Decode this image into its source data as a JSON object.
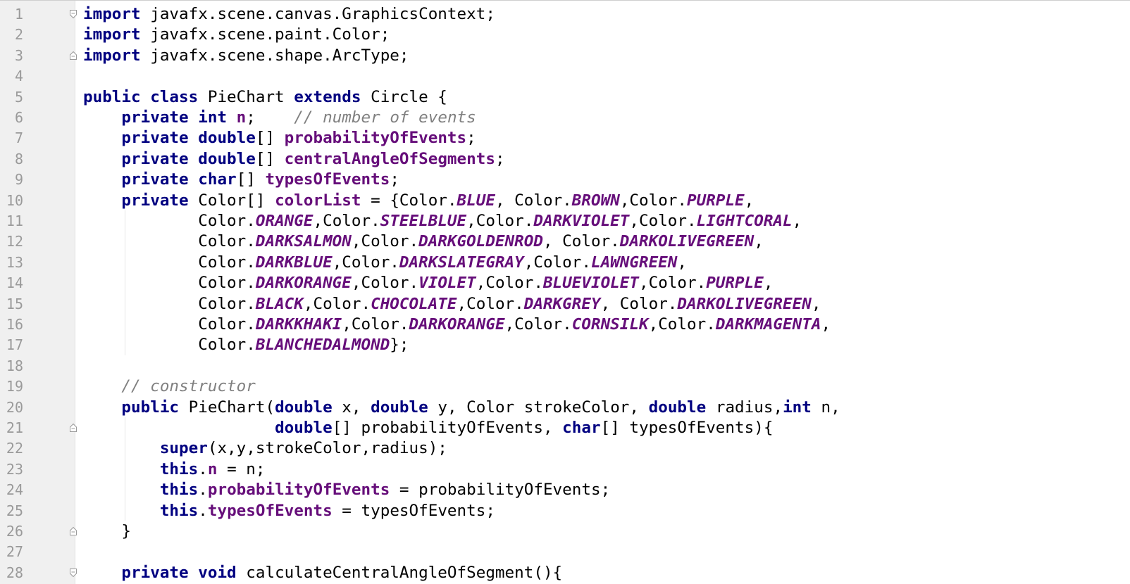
{
  "editor": {
    "language": "Java",
    "colors": {
      "keyword": "#000080",
      "field": "#660e7a",
      "comment": "#808080",
      "plain": "#000000",
      "gutter_bg": "#f0f0f0",
      "line_number": "#9a9a9a"
    },
    "lines": [
      {
        "n": "1",
        "fold": "open",
        "tokens": [
          {
            "t": "import",
            "c": "kw"
          },
          {
            "t": " javafx.scene.canvas.GraphicsContext;",
            "c": "plain"
          }
        ]
      },
      {
        "n": "2",
        "tokens": [
          {
            "t": "import",
            "c": "kw"
          },
          {
            "t": " javafx.scene.paint.Color;",
            "c": "plain"
          }
        ]
      },
      {
        "n": "3",
        "fold": "close",
        "tokens": [
          {
            "t": "import",
            "c": "kw"
          },
          {
            "t": " javafx.scene.shape.ArcType;",
            "c": "plain"
          }
        ]
      },
      {
        "n": "4",
        "tokens": []
      },
      {
        "n": "5",
        "tokens": [
          {
            "t": "public class",
            "c": "kw"
          },
          {
            "t": " PieChart ",
            "c": "plain"
          },
          {
            "t": "extends",
            "c": "kw"
          },
          {
            "t": " Circle {",
            "c": "plain"
          }
        ]
      },
      {
        "n": "6",
        "tokens": [
          {
            "t": "    ",
            "c": "plain"
          },
          {
            "t": "private int",
            "c": "kw"
          },
          {
            "t": " ",
            "c": "plain"
          },
          {
            "t": "n",
            "c": "field"
          },
          {
            "t": ";    ",
            "c": "plain"
          },
          {
            "t": "// number of events",
            "c": "comment"
          }
        ]
      },
      {
        "n": "7",
        "tokens": [
          {
            "t": "    ",
            "c": "plain"
          },
          {
            "t": "private double",
            "c": "kw"
          },
          {
            "t": "[] ",
            "c": "plain"
          },
          {
            "t": "probabilityOfEvents",
            "c": "field"
          },
          {
            "t": ";",
            "c": "plain"
          }
        ]
      },
      {
        "n": "8",
        "tokens": [
          {
            "t": "    ",
            "c": "plain"
          },
          {
            "t": "private double",
            "c": "kw"
          },
          {
            "t": "[] ",
            "c": "plain"
          },
          {
            "t": "centralAngleOfSegments",
            "c": "field"
          },
          {
            "t": ";",
            "c": "plain"
          }
        ]
      },
      {
        "n": "9",
        "tokens": [
          {
            "t": "    ",
            "c": "plain"
          },
          {
            "t": "private char",
            "c": "kw"
          },
          {
            "t": "[] ",
            "c": "plain"
          },
          {
            "t": "typesOfEvents",
            "c": "field"
          },
          {
            "t": ";",
            "c": "plain"
          }
        ]
      },
      {
        "n": "10",
        "tokens": [
          {
            "t": "    ",
            "c": "plain"
          },
          {
            "t": "private",
            "c": "kw"
          },
          {
            "t": " Color[] ",
            "c": "plain"
          },
          {
            "t": "colorList",
            "c": "field"
          },
          {
            "t": " = {Color.",
            "c": "plain"
          },
          {
            "t": "BLUE",
            "c": "const"
          },
          {
            "t": ", Color.",
            "c": "plain"
          },
          {
            "t": "BROWN",
            "c": "const"
          },
          {
            "t": ",Color.",
            "c": "plain"
          },
          {
            "t": "PURPLE",
            "c": "const"
          },
          {
            "t": ",",
            "c": "plain"
          }
        ]
      },
      {
        "n": "11",
        "tokens": [
          {
            "t": "            Color.",
            "c": "plain"
          },
          {
            "t": "ORANGE",
            "c": "const"
          },
          {
            "t": ",Color.",
            "c": "plain"
          },
          {
            "t": "STEELBLUE",
            "c": "const"
          },
          {
            "t": ",Color.",
            "c": "plain"
          },
          {
            "t": "DARKVIOLET",
            "c": "const"
          },
          {
            "t": ",Color.",
            "c": "plain"
          },
          {
            "t": "LIGHTCORAL",
            "c": "const"
          },
          {
            "t": ",",
            "c": "plain"
          }
        ]
      },
      {
        "n": "12",
        "tokens": [
          {
            "t": "            Color.",
            "c": "plain"
          },
          {
            "t": "DARKSALMON",
            "c": "const"
          },
          {
            "t": ",Color.",
            "c": "plain"
          },
          {
            "t": "DARKGOLDENROD",
            "c": "const"
          },
          {
            "t": ", Color.",
            "c": "plain"
          },
          {
            "t": "DARKOLIVEGREEN",
            "c": "const"
          },
          {
            "t": ",",
            "c": "plain"
          }
        ]
      },
      {
        "n": "13",
        "tokens": [
          {
            "t": "            Color.",
            "c": "plain"
          },
          {
            "t": "DARKBLUE",
            "c": "const"
          },
          {
            "t": ",Color.",
            "c": "plain"
          },
          {
            "t": "DARKSLATEGRAY",
            "c": "const"
          },
          {
            "t": ",Color.",
            "c": "plain"
          },
          {
            "t": "LAWNGREEN",
            "c": "const"
          },
          {
            "t": ",",
            "c": "plain"
          }
        ]
      },
      {
        "n": "14",
        "tokens": [
          {
            "t": "            Color.",
            "c": "plain"
          },
          {
            "t": "DARKORANGE",
            "c": "const"
          },
          {
            "t": ",Color.",
            "c": "plain"
          },
          {
            "t": "VIOLET",
            "c": "const"
          },
          {
            "t": ",Color.",
            "c": "plain"
          },
          {
            "t": "BLUEVIOLET",
            "c": "const"
          },
          {
            "t": ",Color.",
            "c": "plain"
          },
          {
            "t": "PURPLE",
            "c": "const"
          },
          {
            "t": ",",
            "c": "plain"
          }
        ]
      },
      {
        "n": "15",
        "tokens": [
          {
            "t": "            Color.",
            "c": "plain"
          },
          {
            "t": "BLACK",
            "c": "const"
          },
          {
            "t": ",Color.",
            "c": "plain"
          },
          {
            "t": "CHOCOLATE",
            "c": "const"
          },
          {
            "t": ",Color.",
            "c": "plain"
          },
          {
            "t": "DARKGREY",
            "c": "const"
          },
          {
            "t": ", Color.",
            "c": "plain"
          },
          {
            "t": "DARKOLIVEGREEN",
            "c": "const"
          },
          {
            "t": ",",
            "c": "plain"
          }
        ]
      },
      {
        "n": "16",
        "tokens": [
          {
            "t": "            Color.",
            "c": "plain"
          },
          {
            "t": "DARKKHAKI",
            "c": "const"
          },
          {
            "t": ",Color.",
            "c": "plain"
          },
          {
            "t": "DARKORANGE",
            "c": "const"
          },
          {
            "t": ",Color.",
            "c": "plain"
          },
          {
            "t": "CORNSILK",
            "c": "const"
          },
          {
            "t": ",Color.",
            "c": "plain"
          },
          {
            "t": "DARKMAGENTA",
            "c": "const"
          },
          {
            "t": ",",
            "c": "plain"
          }
        ]
      },
      {
        "n": "17",
        "tokens": [
          {
            "t": "            Color.",
            "c": "plain"
          },
          {
            "t": "BLANCHEDALMOND",
            "c": "const"
          },
          {
            "t": "};",
            "c": "plain"
          }
        ]
      },
      {
        "n": "18",
        "tokens": []
      },
      {
        "n": "19",
        "tokens": [
          {
            "t": "    ",
            "c": "plain"
          },
          {
            "t": "// constructor",
            "c": "comment"
          }
        ]
      },
      {
        "n": "20",
        "tokens": [
          {
            "t": "    ",
            "c": "plain"
          },
          {
            "t": "public",
            "c": "kw"
          },
          {
            "t": " PieChart(",
            "c": "plain"
          },
          {
            "t": "double",
            "c": "kw"
          },
          {
            "t": " x, ",
            "c": "plain"
          },
          {
            "t": "double",
            "c": "kw"
          },
          {
            "t": " y, Color strokeColor, ",
            "c": "plain"
          },
          {
            "t": "double",
            "c": "kw"
          },
          {
            "t": " radius,",
            "c": "plain"
          },
          {
            "t": "int",
            "c": "kw"
          },
          {
            "t": " n,",
            "c": "plain"
          }
        ]
      },
      {
        "n": "21",
        "fold": "close",
        "tokens": [
          {
            "t": "                    ",
            "c": "plain"
          },
          {
            "t": "double",
            "c": "kw"
          },
          {
            "t": "[] probabilityOfEvents, ",
            "c": "plain"
          },
          {
            "t": "char",
            "c": "kw"
          },
          {
            "t": "[] typesOfEvents){",
            "c": "plain"
          }
        ]
      },
      {
        "n": "22",
        "tokens": [
          {
            "t": "        ",
            "c": "plain"
          },
          {
            "t": "super",
            "c": "kw"
          },
          {
            "t": "(x,y,strokeColor,radius);",
            "c": "plain"
          }
        ]
      },
      {
        "n": "23",
        "tokens": [
          {
            "t": "        ",
            "c": "plain"
          },
          {
            "t": "this",
            "c": "kw"
          },
          {
            "t": ".",
            "c": "plain"
          },
          {
            "t": "n",
            "c": "field"
          },
          {
            "t": " = n;",
            "c": "plain"
          }
        ]
      },
      {
        "n": "24",
        "tokens": [
          {
            "t": "        ",
            "c": "plain"
          },
          {
            "t": "this",
            "c": "kw"
          },
          {
            "t": ".",
            "c": "plain"
          },
          {
            "t": "probabilityOfEvents",
            "c": "field"
          },
          {
            "t": " = probabilityOfEvents;",
            "c": "plain"
          }
        ]
      },
      {
        "n": "25",
        "tokens": [
          {
            "t": "        ",
            "c": "plain"
          },
          {
            "t": "this",
            "c": "kw"
          },
          {
            "t": ".",
            "c": "plain"
          },
          {
            "t": "typesOfEvents",
            "c": "field"
          },
          {
            "t": " = typesOfEvents;",
            "c": "plain"
          }
        ]
      },
      {
        "n": "26",
        "fold": "close",
        "tokens": [
          {
            "t": "    }",
            "c": "plain"
          }
        ]
      },
      {
        "n": "27",
        "tokens": []
      },
      {
        "n": "28",
        "fold": "open",
        "tokens": [
          {
            "t": "    ",
            "c": "plain"
          },
          {
            "t": "private void",
            "c": "kw"
          },
          {
            "t": " calculateCentralAngleOfSegment(){",
            "c": "plain"
          }
        ]
      }
    ]
  }
}
